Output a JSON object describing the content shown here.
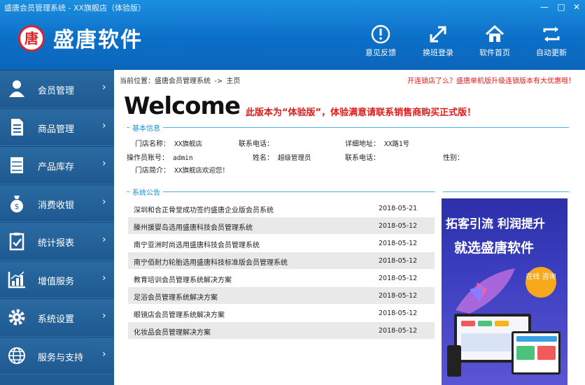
{
  "window": {
    "title": "盛唐会员管理系统 - XX旗舰店（体验版）"
  },
  "brand": {
    "logo_char": "唐",
    "name": "盛唐软件"
  },
  "toolbar": [
    {
      "label": "意见反馈",
      "icon": "exclamation-icon"
    },
    {
      "label": "换班登录",
      "icon": "arrows-diagonal-icon"
    },
    {
      "label": "软件首页",
      "icon": "home-icon"
    },
    {
      "label": "自动更新",
      "icon": "refresh-icon"
    }
  ],
  "sidebar": {
    "items": [
      {
        "label": "会员管理",
        "icon": "user-icon"
      },
      {
        "label": "商品管理",
        "icon": "document-icon"
      },
      {
        "label": "产品库存",
        "icon": "cabinet-icon"
      },
      {
        "label": "消费收银",
        "icon": "money-bag-icon"
      },
      {
        "label": "统计报表",
        "icon": "clipboard-check-icon"
      },
      {
        "label": "增值服务",
        "icon": "chart-icon"
      },
      {
        "label": "系统设置",
        "icon": "gear-icon"
      },
      {
        "label": "服务与支持",
        "icon": "globe-icon"
      }
    ],
    "chevron": "›"
  },
  "breadcrumb": {
    "prefix": "当前位置：",
    "root": "盛唐会员管理系统",
    "sep": "->",
    "current": "主页"
  },
  "promo": "开连锁店了么？盛唐单机版升级连锁版本有大优惠哦！",
  "welcome": {
    "title": "Welcome",
    "notice": "此版本为“体验版”，体验满意请联系销售商购买正式版！"
  },
  "basic_info": {
    "section_title": "基本信息",
    "store_name_label": "门店名称：",
    "store_name": "XX旗舰店",
    "store_phone_label": "联系电话：",
    "store_phone": "",
    "address_label": "详细地址：",
    "address": "XX路1号",
    "operator_label": "操作员账号：",
    "operator": "admin",
    "name_label": "姓名：",
    "name": "超级管理员",
    "op_phone_label": "联系电话：",
    "op_phone": "",
    "gender_label": "性别：",
    "gender": "",
    "intro_label": "门店简介：",
    "intro": "XX旗舰店欢迎您！"
  },
  "announcements": {
    "section_title": "系统公告",
    "rows": [
      {
        "title": "深圳和合正骨堂成功签约盛唐企业版会员系统",
        "date": "2018-05-21"
      },
      {
        "title": "滕州援婴岛选用盛唐科技会员管理系统",
        "date": "2018-05-12"
      },
      {
        "title": "南宁亚洲时尚选用盛唐科技会员管理系统",
        "date": "2018-05-12"
      },
      {
        "title": "南宁佰耐力轮胎选用盛唐科技标准版会员管理系统",
        "date": "2018-05-12"
      },
      {
        "title": "教育培训会员管理系统解决方案",
        "date": "2018-05-12"
      },
      {
        "title": "足浴会员管理系统解决方案",
        "date": "2018-05-12"
      },
      {
        "title": "眼镜店会员管理系统解决方案",
        "date": "2018-05-12"
      },
      {
        "title": "化妆品会员管理解决方案",
        "date": "2018-05-12"
      }
    ]
  },
  "ad": {
    "line1": "拓客引流 利润提升",
    "line2": "就选盛唐软件",
    "badge": "在线 咨询"
  },
  "colors": {
    "header": "#0c6fc7",
    "sidebar": "#1f5d93",
    "accent": "#1a8fd6",
    "alert": "#e21a1a"
  }
}
